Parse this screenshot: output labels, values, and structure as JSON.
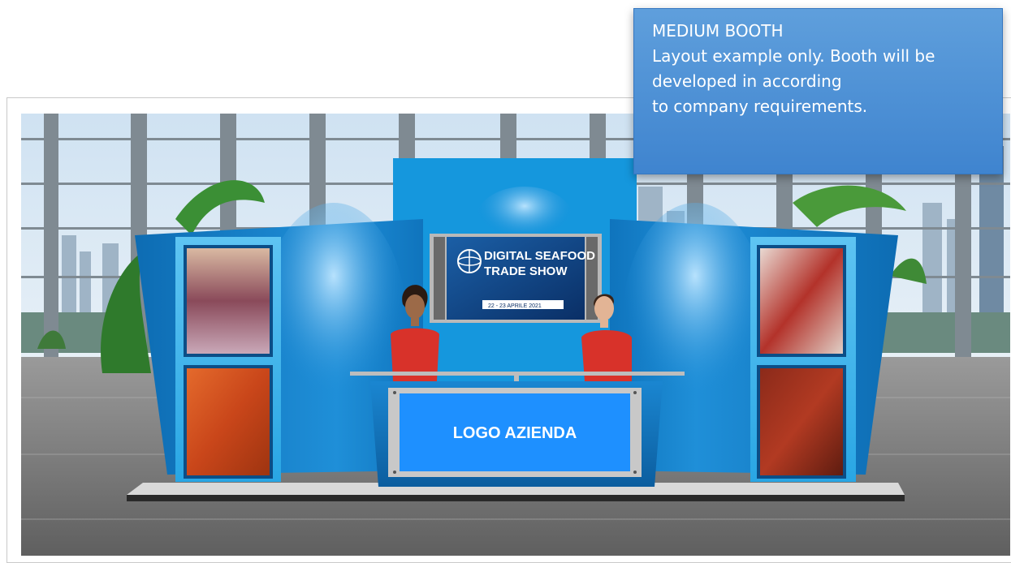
{
  "callout": {
    "title": "MEDIUM BOOTH",
    "line1": "Layout example only. Booth will be",
    "line2": "developed in according",
    "line3": "to company requirements."
  },
  "booth": {
    "screen_title_1": "DIGITAL SEAFOOD",
    "screen_title_2": "TRADE SHOW",
    "screen_date": "22 - 23 APRILE 2021",
    "desk_logo": "LOGO AZIENDA"
  },
  "colors": {
    "booth_blue": "#1da1e6",
    "booth_dark": "#0b6fb8",
    "desk_panel": "#1e90ff",
    "callout_bg": "#4a90d9"
  },
  "icons": {
    "left_panel_top": "seafood-market-photo",
    "left_panel_bottom": "shrimp-photo",
    "right_panel_top": "fish-photo",
    "right_panel_bottom": "lobster-photo",
    "screen_logo": "globe-icon"
  }
}
